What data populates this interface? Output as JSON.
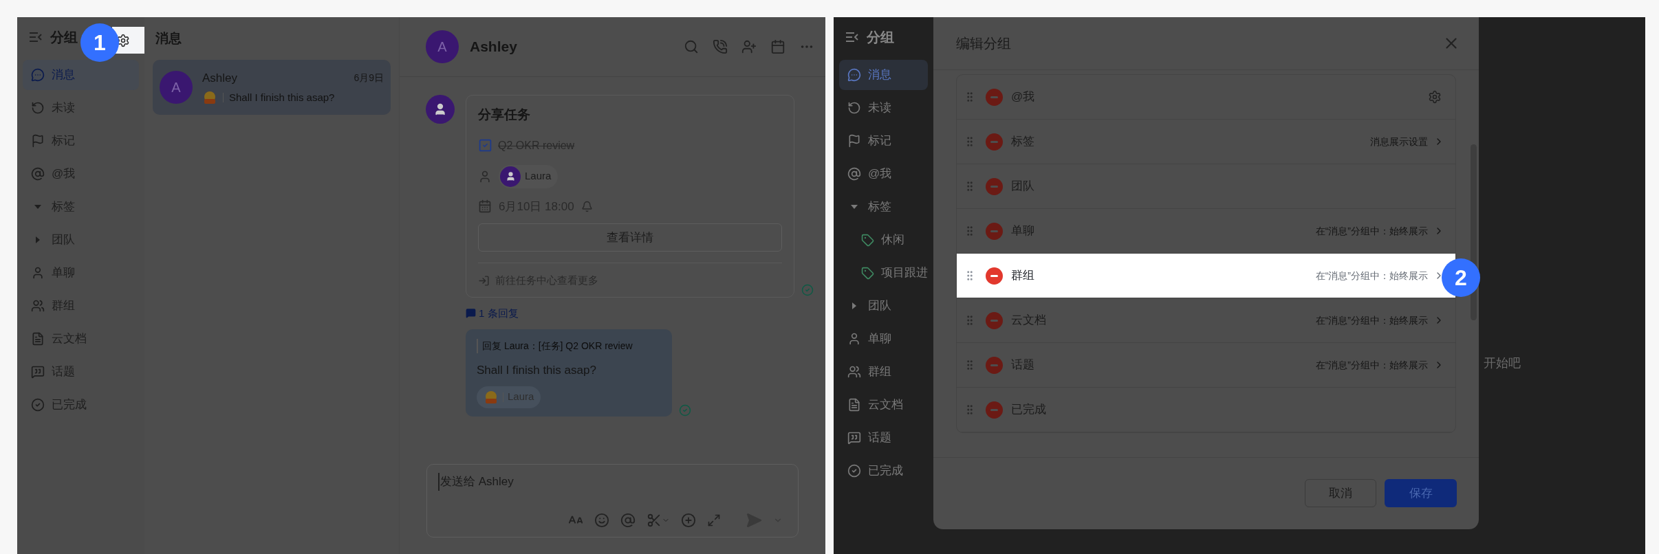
{
  "left_screen": {
    "sidebar": {
      "title": "分组",
      "items": [
        {
          "label": "消息",
          "kind": "item",
          "selected": true
        },
        {
          "label": "未读",
          "kind": "item",
          "selected": false
        },
        {
          "label": "标记",
          "kind": "item",
          "selected": false
        },
        {
          "label": "@我",
          "kind": "item",
          "selected": false
        },
        {
          "label": "标签",
          "kind": "folder",
          "selected": false,
          "expanded": true
        },
        {
          "label": "团队",
          "kind": "folder",
          "selected": false,
          "expanded": false
        },
        {
          "label": "单聊",
          "kind": "item",
          "selected": false
        },
        {
          "label": "群组",
          "kind": "item",
          "selected": false
        },
        {
          "label": "云文档",
          "kind": "item",
          "selected": false
        },
        {
          "label": "话题",
          "kind": "item",
          "selected": false
        },
        {
          "label": "已完成",
          "kind": "item",
          "selected": false
        }
      ]
    },
    "badge": "1",
    "message_list": {
      "title": "消息",
      "conversations": [
        {
          "avatar": "A",
          "name": "Ashley",
          "date": "6月9日",
          "preview": "Shall I finish this asap?",
          "selected": true
        }
      ]
    },
    "chat": {
      "header": {
        "avatar": "A",
        "name": "Ashley"
      },
      "task_card": {
        "title": "分享任务",
        "task": "Q2 OKR review",
        "done": true,
        "assignee": "Laura",
        "due": "6月10日 18:00",
        "details_button": "查看详情",
        "footer_link": "前往任务中心查看更多"
      },
      "reply_link": "1 条回复",
      "reply_bubble": {
        "quote": "回复 Laura：[任务] Q2 OKR review",
        "text": "Shall I finish this asap?",
        "reaction_user": "Laura"
      },
      "composer": {
        "placeholder": "发送给 Ashley"
      }
    }
  },
  "right_screen": {
    "sidebar": {
      "title": "分组",
      "items": [
        {
          "label": "消息",
          "kind": "item",
          "selected": true
        },
        {
          "label": "未读",
          "kind": "item",
          "selected": false
        },
        {
          "label": "标记",
          "kind": "item",
          "selected": false
        },
        {
          "label": "@我",
          "kind": "item",
          "selected": false
        },
        {
          "label": "标签",
          "kind": "folder",
          "selected": false,
          "expanded": true,
          "children": [
            {
              "label": "休闲",
              "kind": "tag",
              "selected": false
            },
            {
              "label": "项目跟进",
              "kind": "tag",
              "selected": false
            }
          ]
        },
        {
          "label": "团队",
          "kind": "folder",
          "selected": false,
          "expanded": false
        },
        {
          "label": "单聊",
          "kind": "item",
          "selected": false
        },
        {
          "label": "群组",
          "kind": "item",
          "selected": false
        },
        {
          "label": "云文档",
          "kind": "item",
          "selected": false
        },
        {
          "label": "话题",
          "kind": "item",
          "selected": false
        },
        {
          "label": "已完成",
          "kind": "item",
          "selected": false
        }
      ]
    },
    "background_text": "开始吧",
    "dialog": {
      "title": "编辑分组",
      "badge": "2",
      "groups": [
        {
          "label": "@我",
          "kind": "gear",
          "highlighted": false
        },
        {
          "label": "标签",
          "kind": "link",
          "setting": "消息展示设置",
          "highlighted": false
        },
        {
          "label": "团队",
          "kind": "plain",
          "highlighted": false
        },
        {
          "label": "单聊",
          "kind": "link",
          "setting": "在“消息”分组中：始终展示",
          "highlighted": false
        },
        {
          "label": "群组",
          "kind": "link",
          "setting": "在“消息”分组中：始终展示",
          "highlighted": true
        },
        {
          "label": "云文档",
          "kind": "link",
          "setting": "在“消息”分组中：始终展示",
          "highlighted": false
        },
        {
          "label": "话题",
          "kind": "link",
          "setting": "在“消息”分组中：始终展示",
          "highlighted": false
        },
        {
          "label": "已完成",
          "kind": "plain",
          "highlighted": false
        }
      ],
      "cancel_button": "取消",
      "save_button": "保存"
    }
  }
}
